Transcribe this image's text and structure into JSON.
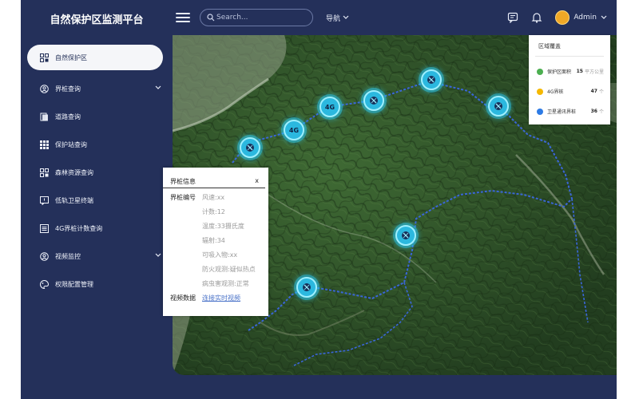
{
  "app": {
    "title": "自然保护区监测平台"
  },
  "topbar": {
    "search_placeholder": "Search...",
    "nav_label": "导航",
    "username": "Admin"
  },
  "sidebar": {
    "items": [
      {
        "label": "自然保护区",
        "icon": "grid-icon",
        "active": true
      },
      {
        "label": "界桩查询",
        "icon": "user-circle-icon",
        "has_submenu": true
      },
      {
        "label": "道路查询",
        "icon": "document-icon"
      },
      {
        "label": "保护站查询",
        "icon": "dots-grid-icon"
      },
      {
        "label": "森林资源查询",
        "icon": "grid-icon"
      },
      {
        "label": "低轨卫星终端",
        "icon": "message-alert-icon"
      },
      {
        "label": "4G界桩计数查询",
        "icon": "list-icon"
      },
      {
        "label": "视频监控",
        "icon": "user-circle-icon",
        "has_submenu": true
      },
      {
        "label": "权限配置管理",
        "icon": "palette-icon"
      }
    ]
  },
  "legend": {
    "title": "区域覆盖",
    "items": [
      {
        "label": "保护区面积",
        "value": "15",
        "unit": "平方公里",
        "color": "#4caf50"
      },
      {
        "label": "4G界桩",
        "value": "47",
        "unit": "个",
        "color": "#f5b800"
      },
      {
        "label": "卫星通讯界桩",
        "value": "36",
        "unit": "个",
        "color": "#2d7be5"
      }
    ]
  },
  "popup": {
    "title": "界桩信息",
    "close": "x",
    "id_label": "界桩编号",
    "fields": [
      "风速:xx",
      "计数:12",
      "温度:33摄氏度",
      "辐射:34",
      "可吸入物:xx",
      "防火观测:疑似热点",
      "病虫害观测:正常"
    ],
    "video_label": "视频数据",
    "video_link": "连接实时视频"
  },
  "markers": [
    "",
    "4G",
    "4G",
    "",
    "",
    "",
    "",
    ""
  ],
  "colors": {
    "sidebar_bg": "#24305a",
    "marker": "#2bb8df"
  }
}
